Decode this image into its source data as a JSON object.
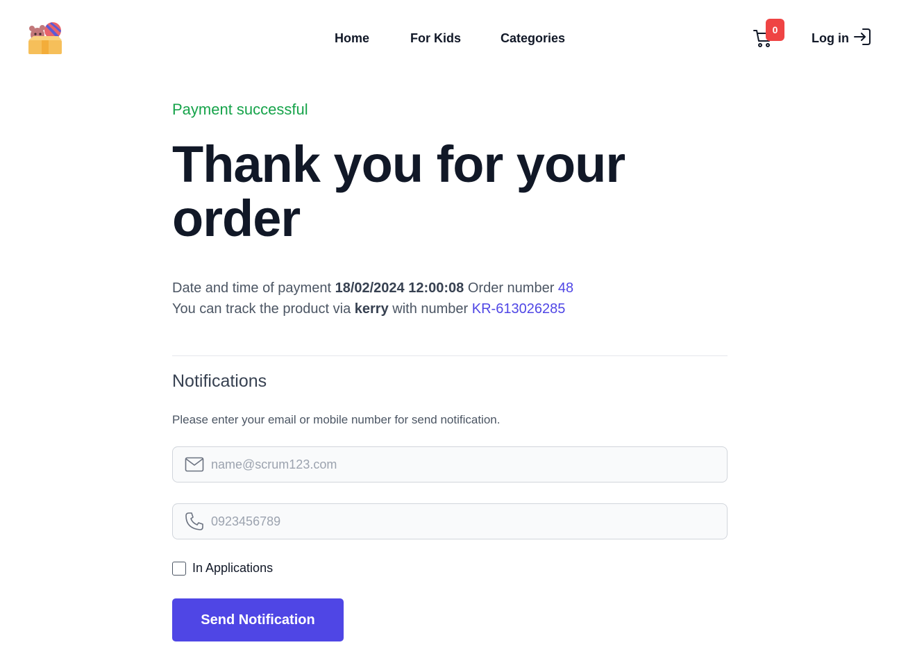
{
  "nav": {
    "items": [
      {
        "label": "Home"
      },
      {
        "label": "For Kids"
      },
      {
        "label": "Categories"
      }
    ],
    "cart_count": "0",
    "login_label": "Log in"
  },
  "main": {
    "status": "Payment successful",
    "title": "Thank you for your order",
    "payment_label": "Date and time of payment",
    "payment_datetime": "18/02/2024 12:00:08",
    "order_label": "Order number",
    "order_number": "48",
    "track_prefix": "You can track the product via",
    "carrier": "kerry",
    "track_middle": "with number",
    "tracking_number": "KR-613026285"
  },
  "notifications": {
    "title": "Notifications",
    "description": "Please enter your email or mobile number for send notification.",
    "email_placeholder": "name@scrum123.com",
    "phone_placeholder": "0923456789",
    "checkbox_label": "In Applications",
    "checkbox_checked": false,
    "send_label": "Send Notification"
  },
  "colors": {
    "accent": "#4f46e5",
    "success": "#16a34a",
    "badge": "#ef4444"
  },
  "icons": {
    "logo": "toy-box-logo-icon",
    "cart": "shopping-cart-icon",
    "login": "login-arrow-icon",
    "email": "envelope-icon",
    "phone": "phone-icon"
  }
}
